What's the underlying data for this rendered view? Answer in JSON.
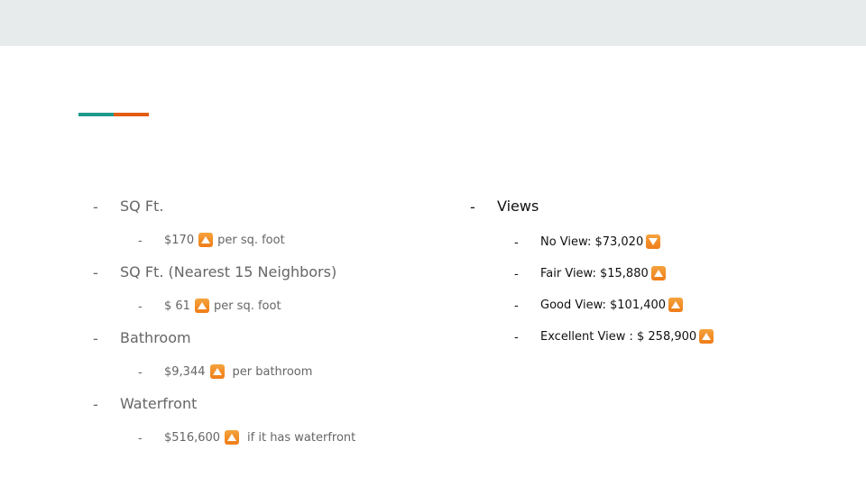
{
  "colors": {
    "accent_teal": "#1f9b8e",
    "accent_orange": "#e35d10",
    "band": "#e8ebeb",
    "arrow": "#f08a1f"
  },
  "bullet": "-",
  "left": {
    "items": [
      {
        "label": "SQ Ft.",
        "sub": {
          "value": "$170",
          "arrow": "up-arrow-icon",
          "suffix": "per sq. foot"
        }
      },
      {
        "label": "SQ Ft. (Nearest 15 Neighbors)",
        "sub": {
          "value": "$ 61",
          "arrow": "up-arrow-icon",
          "suffix": "per sq. foot"
        }
      },
      {
        "label": "Bathroom",
        "sub": {
          "value": "$9,344",
          "arrow": "up-arrow-icon",
          "suffix": "per bathroom"
        }
      },
      {
        "label": "Waterfront",
        "sub": {
          "value": "$516,600",
          "arrow": "up-arrow-icon",
          "suffix": "if it has waterfront"
        }
      }
    ]
  },
  "right": {
    "label": "Views",
    "subs": [
      {
        "text": "No View: $73,020",
        "arrow": "down-arrow-icon"
      },
      {
        "text": "Fair View:  $15,880",
        "arrow": "up-arrow-icon"
      },
      {
        "text": "Good View: $101,400",
        "arrow": "up-arrow-icon"
      },
      {
        "text": "Excellent View : $ 258,900",
        "arrow": "up-arrow-icon"
      }
    ]
  }
}
